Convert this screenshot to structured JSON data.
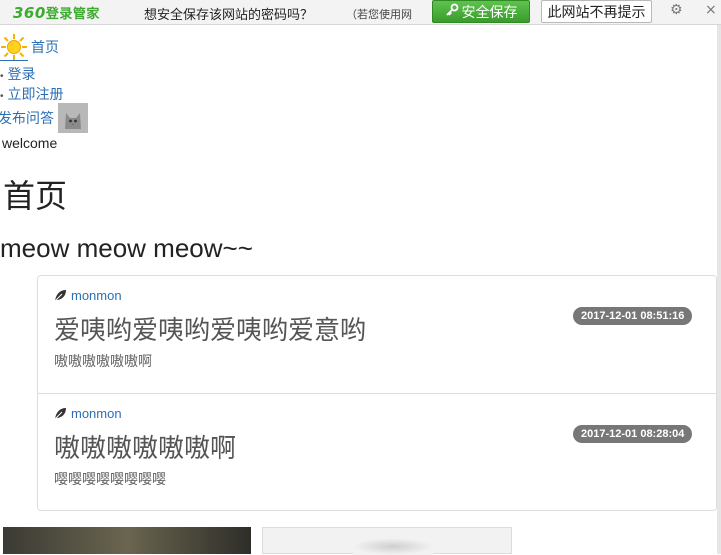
{
  "pw_bar": {
    "logo_num": "360",
    "logo_text": "登录管家",
    "question": "想安全保存该网站的密码吗？",
    "note": "（若您使用网",
    "save_label": "安全保存",
    "dont_remind_label": "此网站不再提示",
    "settings_icon": "gear-icon",
    "close_icon": "close-icon",
    "accent": "#3dab2f"
  },
  "nav": {
    "home": "首页",
    "items": [
      "登录",
      "立即注册"
    ],
    "ask": "发布问答",
    "welcome": "welcome"
  },
  "page": {
    "heading": "首页",
    "subheading": "meow meow meow~~"
  },
  "posts": [
    {
      "author": "monmon",
      "title": "爱咦哟爱咦哟爱咦哟爱意哟",
      "body": "嗷嗷嗷嗷嗷嗷啊",
      "time": "2017-12-01 08:51:16"
    },
    {
      "author": "monmon",
      "title": "嗷嗷嗷嗷嗷嗷啊",
      "body": "嘤嘤嘤嘤嘤嘤嘤嘤",
      "time": "2017-12-01 08:28:04"
    }
  ]
}
